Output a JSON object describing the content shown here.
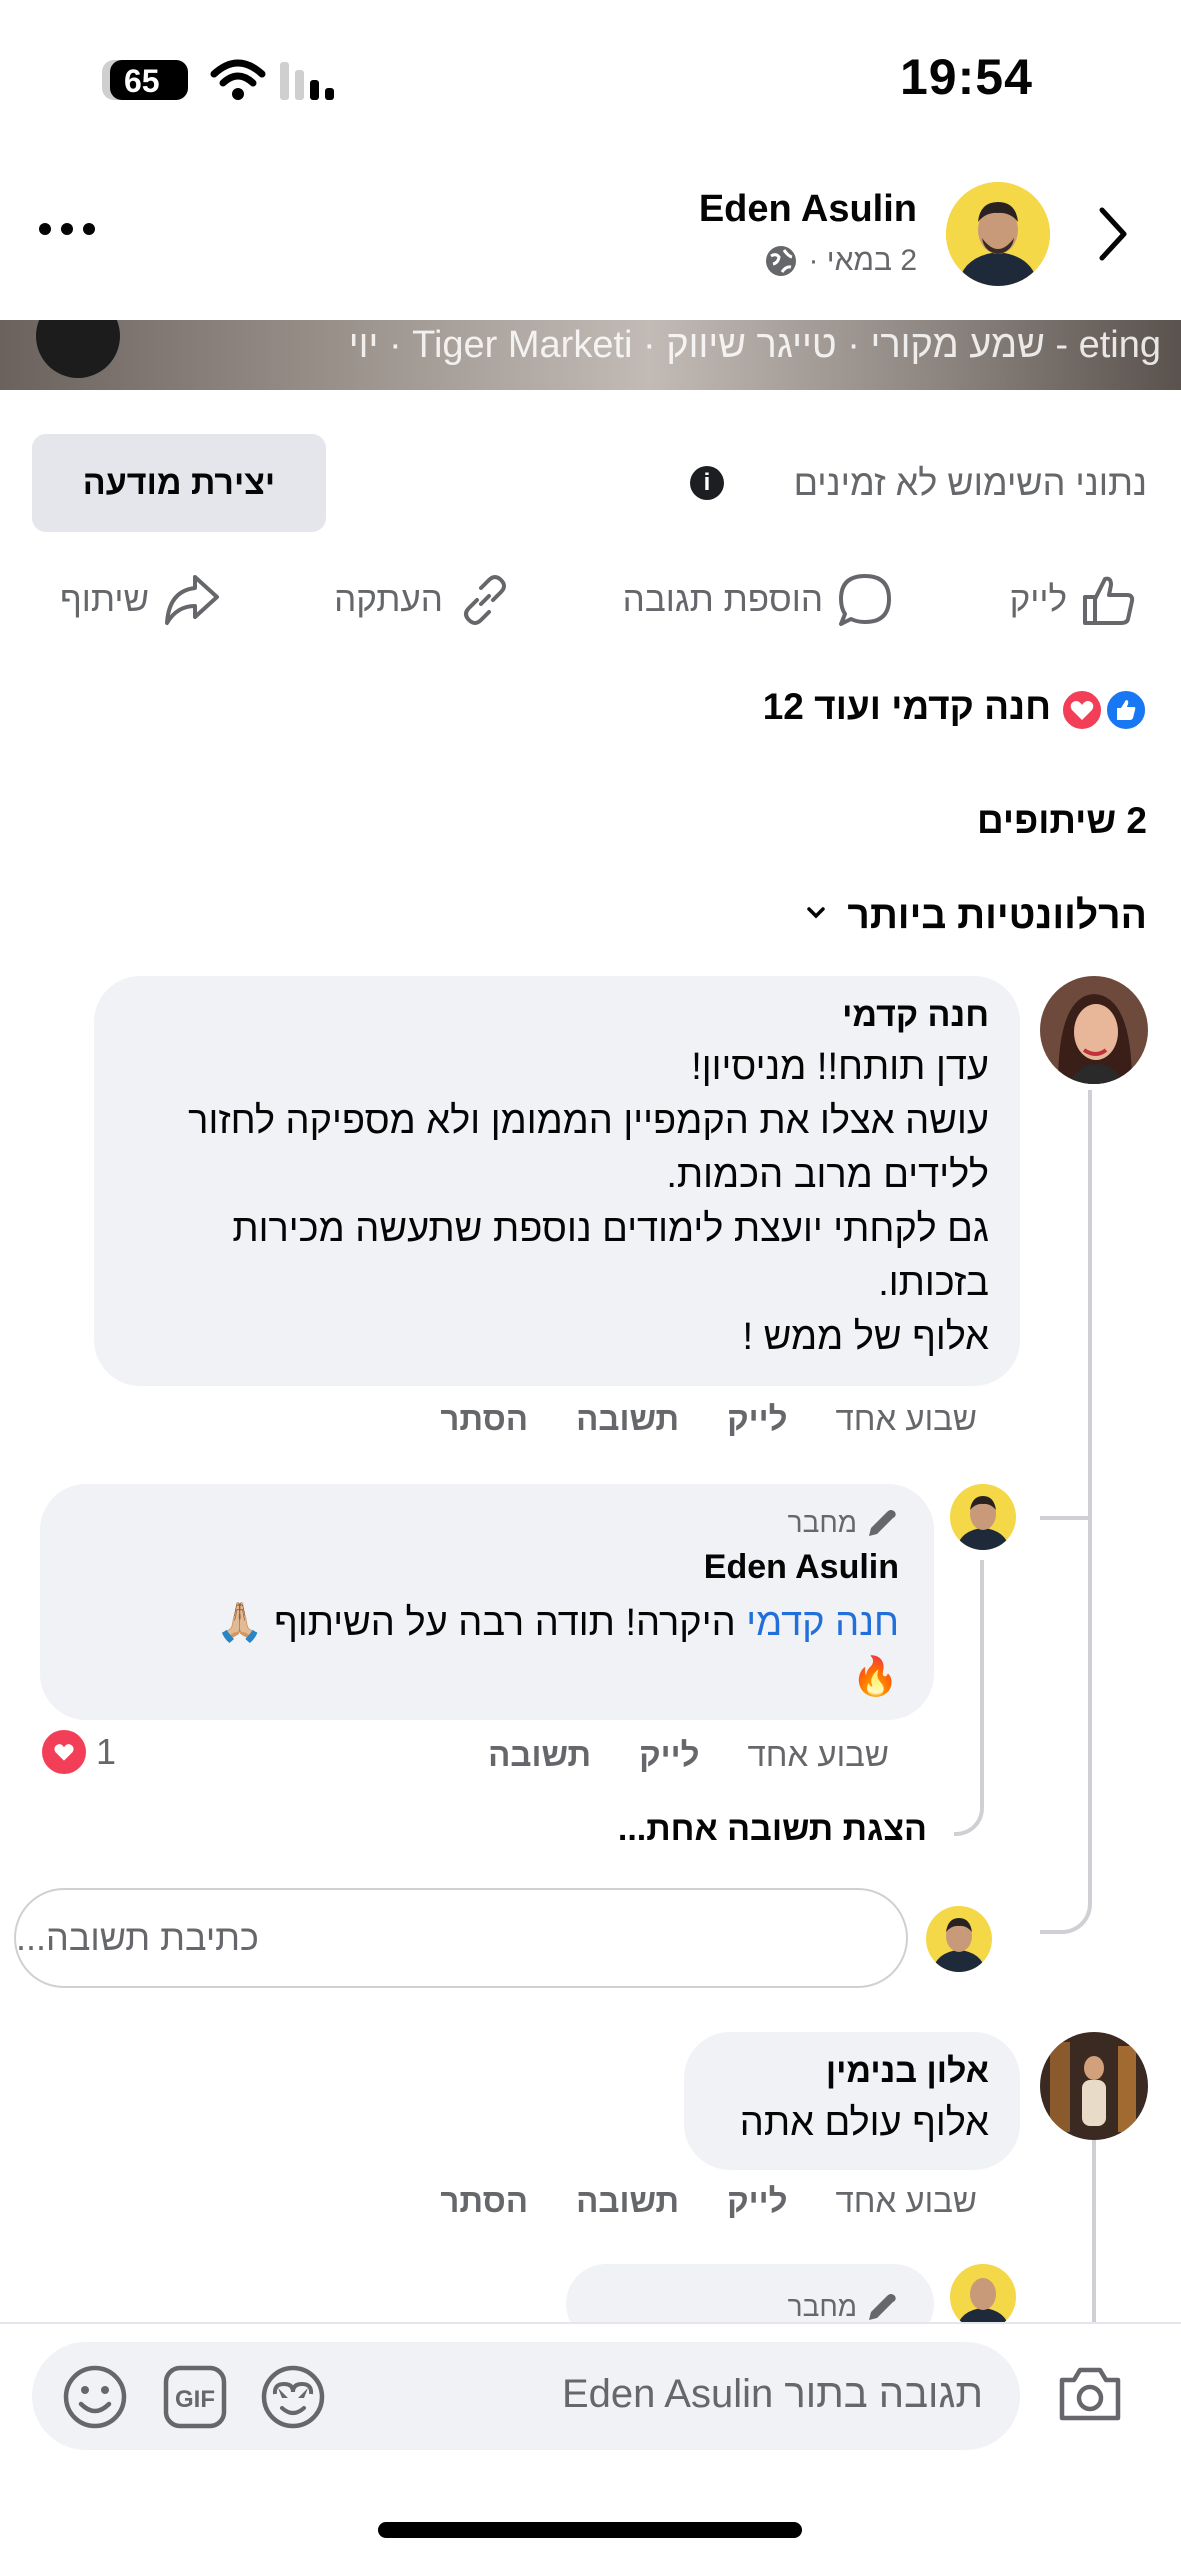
{
  "status_bar": {
    "time": "19:54",
    "battery": "65"
  },
  "header": {
    "name": "Eden Asulin",
    "date": "2 במאי ·"
  },
  "video": {
    "caption": "יוי · Tiger Marketi · שמע מקורי · טייגר שיווק - eting"
  },
  "insights": {
    "text": "נתוני השימוש לא זמינים",
    "button": "יצירת מודעה"
  },
  "actions": {
    "like": "לייק",
    "comment": "הוספת תגובה",
    "copy": "העתקה",
    "share": "שיתוף"
  },
  "reactions": {
    "text": "חנה קדמי ועוד 12"
  },
  "shares": {
    "text": "2 שיתופים"
  },
  "sort": {
    "label": "הרלוונטיות ביותר"
  },
  "comments": [
    {
      "name": "חנה קדמי",
      "lines": [
        "עדן תותח!! מניסיון!",
        "עושה אצלו את הקמפיין הממומן ולא מספיקה לחזור",
        "ללידים מרוב הכמות.",
        "גם לקחתי יועצת לימודים נוספת שתעשה מכירות",
        "בזכותו.",
        "אלוף של ממש !"
      ],
      "time": "שבוע אחד",
      "like": "לייק",
      "reply": "תשובה",
      "hide": "הסתר"
    },
    {
      "name": "אלון בנימין",
      "lines": [
        "אלוף עולם אתה"
      ],
      "time": "שבוע אחד",
      "like": "לייק",
      "reply": "תשובה",
      "hide": "הסתר"
    }
  ],
  "reply": {
    "badge": "מחבר",
    "name": "Eden Asulin",
    "mention": "חנה קדמי",
    "text": " היקרה! תודה רבה על השיתוף 🙏🏼",
    "emoji": "🔥",
    "time": "שבוע אחד",
    "like": "לייק",
    "reply": "תשובה",
    "reaction_count": "1",
    "view_more": "הצגת תשובה אחת..."
  },
  "reply_input": {
    "placeholder": "כתיבת תשובה..."
  },
  "composer": {
    "placeholder": "תגובה בתור Eden Asulin"
  },
  "colors": {
    "link": "#216fdb",
    "like_blue": "#1877f2",
    "love_red": "#f33e58",
    "bubble": "#f0f2f5"
  }
}
